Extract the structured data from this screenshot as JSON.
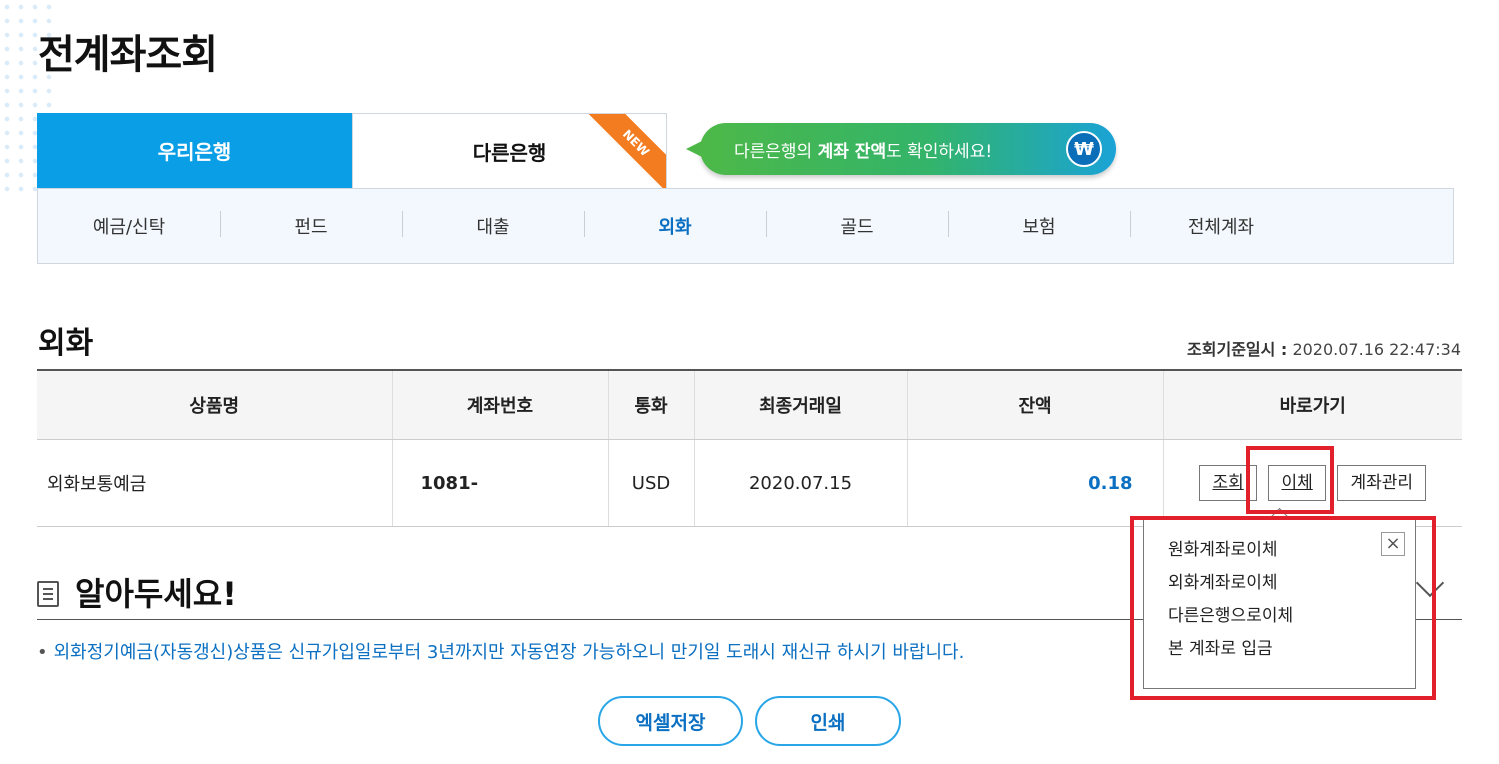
{
  "page": {
    "title": "전계좌조회"
  },
  "bank_tabs": [
    {
      "label": "우리은행",
      "active": true
    },
    {
      "label": "다른은행",
      "badge": "NEW"
    }
  ],
  "promo_bubble": {
    "pre": "다른은행의 ",
    "bold": "계좌 잔액",
    "post": "도 확인하세요!",
    "icon": "won-icon"
  },
  "categories": [
    {
      "label": "예금/신탁"
    },
    {
      "label": "펀드"
    },
    {
      "label": "대출"
    },
    {
      "label": "외화",
      "active": true
    },
    {
      "label": "골드"
    },
    {
      "label": "보험"
    },
    {
      "label": "전체계좌"
    }
  ],
  "section": {
    "title": "외화",
    "timestamp_label": "조회기준일시 :",
    "timestamp_value": "2020.07.16 22:47:34"
  },
  "table": {
    "headers": [
      "상품명",
      "계좌번호",
      "통화",
      "최종거래일",
      "잔액",
      "바로가기"
    ],
    "rows": [
      {
        "name": "외화보통예금",
        "account": "1081-",
        "currency": "USD",
        "last_date": "2020.07.15",
        "balance": "0.18"
      }
    ],
    "actions": [
      "조회",
      "이체",
      "계좌관리"
    ]
  },
  "transfer_menu": {
    "items": [
      "원화계좌로이체",
      "외화계좌로이체",
      "다른은행으로이체",
      "본 계좌로 입금"
    ],
    "close_symbol": "×"
  },
  "notice": {
    "title": "알아두세요!",
    "text": "외화정기예금(자동갱신)상품은 신규가입일로부터 3년까지만 자동연장 가능하오니 만기일 도래시 재신규 하시기 바랍니다."
  },
  "buttons": {
    "excel": "엑셀저장",
    "print": "인쇄"
  },
  "colors": {
    "brand_blue": "#0a9ee6",
    "link_blue": "#0b6fc2",
    "highlight_red": "#e2202b",
    "new_orange": "#f47c20"
  }
}
